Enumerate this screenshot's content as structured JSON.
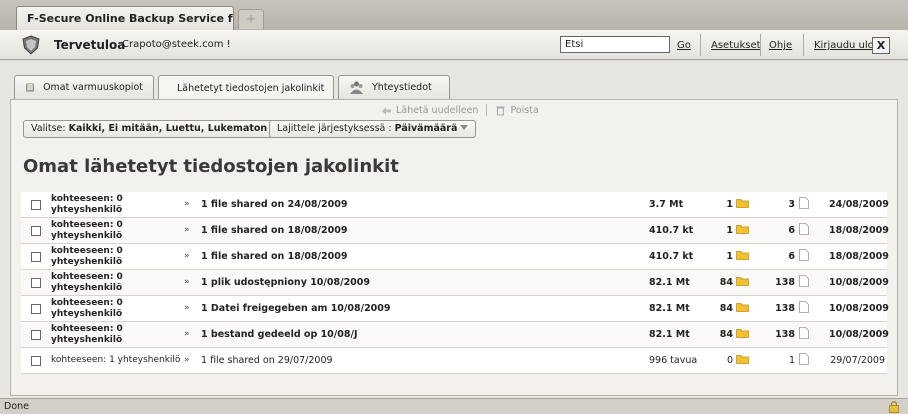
{
  "browser": {
    "tab_title": "F-Secure Online Backup Service for C...",
    "new_tab_label": "+",
    "status_text": "Done"
  },
  "header": {
    "welcome": "Tervetuloa",
    "email": "Crapoto@steek.com !",
    "search_placeholder": "Etsi",
    "go_label": "Go",
    "settings_label": "Asetukset",
    "help_label": "Ohje",
    "logout_label": "Kirjaudu ulos",
    "close_label": "X"
  },
  "tabs": [
    {
      "label": "Omat varmuuskopiot",
      "icon": "folder-icon"
    },
    {
      "label": "Lähetetyt tiedostojen jakolinkit",
      "icon": "users-icon"
    },
    {
      "label": "Yhteystiedot",
      "icon": "contacts-icon"
    }
  ],
  "actions": {
    "resend_label": "Lähetä uudelleen",
    "delete_label": "Poista"
  },
  "filter": {
    "prefix": "Valitse: ",
    "options": "Kaikki, Ei mitään, Luettu, Lukematon"
  },
  "sort": {
    "prefix": "Lajittele järjestyksessä : ",
    "value": "Päivämäärä"
  },
  "page_title": "Omat lähetetyt tiedostojen jakolinkit",
  "rows": [
    {
      "recipient_line1": "kohteeseen: 0",
      "recipient_line2": "yhteyshenkilö",
      "description": "1 file shared on 24/08/2009",
      "size": "3.7 Mt",
      "folders": "1",
      "files": "3",
      "date": "24/08/2009",
      "bold": true
    },
    {
      "recipient_line1": "kohteeseen: 0",
      "recipient_line2": "yhteyshenkilö",
      "description": "1 file shared on 18/08/2009",
      "size": "410.7 kt",
      "folders": "1",
      "files": "6",
      "date": "18/08/2009",
      "bold": true
    },
    {
      "recipient_line1": "kohteeseen: 0",
      "recipient_line2": "yhteyshenkilö",
      "description": "1 file shared on 18/08/2009",
      "size": "410.7 kt",
      "folders": "1",
      "files": "6",
      "date": "18/08/2009",
      "bold": true
    },
    {
      "recipient_line1": "kohteeseen: 0",
      "recipient_line2": "yhteyshenkilö",
      "description": "1 plik udostępniony 10/08/2009",
      "size": "82.1 Mt",
      "folders": "84",
      "files": "138",
      "date": "10/08/2009",
      "bold": true
    },
    {
      "recipient_line1": "kohteeseen: 0",
      "recipient_line2": "yhteyshenkilö",
      "description": "1 Datei freigegeben am 10/08/2009",
      "size": "82.1 Mt",
      "folders": "84",
      "files": "138",
      "date": "10/08/2009",
      "bold": true
    },
    {
      "recipient_line1": "kohteeseen: 0",
      "recipient_line2": "yhteyshenkilö",
      "description": "1 bestand gedeeld op 10/08/J",
      "size": "82.1 Mt",
      "folders": "84",
      "files": "138",
      "date": "10/08/2009",
      "bold": true
    },
    {
      "recipient_line1": "kohteeseen: 1 yhteyshenkilö",
      "recipient_line2": "",
      "description": "1 file shared on 29/07/2009",
      "size": "996 tavua",
      "folders": "0",
      "files": "1",
      "date": "29/07/2009",
      "bold": false
    }
  ],
  "expand_glyph": "»",
  "colors": {
    "folder": "#f2c030",
    "accent": "#3a3a3a"
  }
}
